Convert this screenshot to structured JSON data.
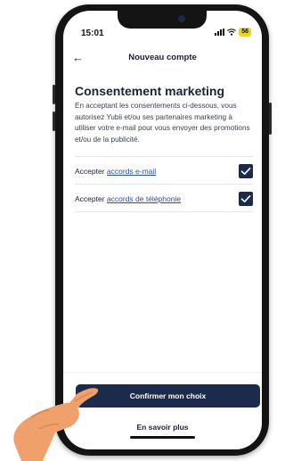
{
  "status_bar": {
    "time": "15:01",
    "battery": "56",
    "battery_color": "#f5d211"
  },
  "nav": {
    "back_icon": "arrow-left-icon",
    "title": "Nouveau compte"
  },
  "main": {
    "heading": "Consentement marketing",
    "description": "En acceptant les consentements ci-dessous, vous autorisez Yubii et/ou ses partenaires marketing à utiliser votre e-mail pour vous envoyer des promotions et/ou de la publicité."
  },
  "consents": [
    {
      "prefix": "Accepter ",
      "link": "accords e-mail",
      "checked": true
    },
    {
      "prefix": "Accepter ",
      "link": "accords de téléphonie",
      "checked": true
    }
  ],
  "actions": {
    "confirm_label": "Confirmer mon choix",
    "more_label": "En savoir plus"
  },
  "colors": {
    "primary": "#1c2b4c",
    "link": "#2a4ea0"
  }
}
